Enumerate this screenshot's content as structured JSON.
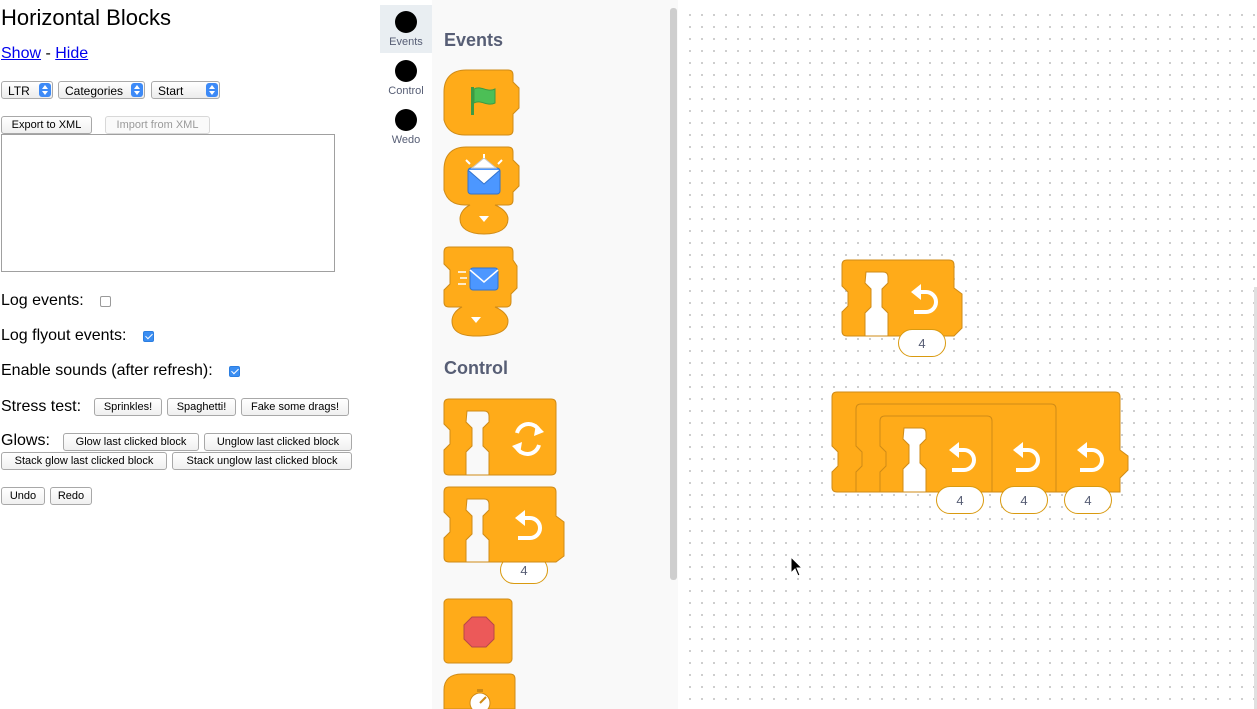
{
  "page": {
    "title": "Horizontal Blocks",
    "show_link": "Show",
    "separator": " - ",
    "hide_link": "Hide"
  },
  "controls": {
    "direction_select": "LTR",
    "toolbox_select": "Categories",
    "position_select": "Start",
    "export_button": "Export to XML",
    "import_button": "Import from XML",
    "xml_textarea_value": "",
    "log_events_label": "Log events:",
    "log_events_checked": false,
    "log_flyout_label": "Log flyout events:",
    "log_flyout_checked": true,
    "sounds_label": "Enable sounds (after refresh):",
    "sounds_checked": true,
    "stress_label": "Stress test:",
    "stress_buttons": [
      "Sprinkles!",
      "Spaghetti!",
      "Fake some drags!"
    ],
    "glows_label": "Glows:",
    "glow_buttons": [
      "Glow last clicked block",
      "Unglow last clicked block",
      "Stack glow last clicked block",
      "Stack unglow last clicked block"
    ],
    "undo_button": "Undo",
    "redo_button": "Redo"
  },
  "categories": [
    {
      "label": "Events",
      "active": true
    },
    {
      "label": "Control",
      "active": false
    },
    {
      "label": "Wedo",
      "active": false
    }
  ],
  "flyout": {
    "events_heading": "Events",
    "control_heading": "Control",
    "repeat_count": "4"
  },
  "workspace": {
    "repeat_block_count": "4",
    "nested_repeat_counts": [
      "4",
      "4",
      "4"
    ]
  },
  "colors": {
    "block_fill": "#ffab19",
    "block_stroke": "#cf8b17",
    "heading_text": "#575e75",
    "checkbox_blue": "#3b8ef2",
    "stop_red": "#ec5959",
    "flag_green": "#4cbf56"
  },
  "icons": [
    "green-flag-icon",
    "broadcast-receive-icon",
    "broadcast-send-icon",
    "forever-arrows-icon",
    "repeat-arrow-icon",
    "stop-sign-icon",
    "timer-icon",
    "dropdown-arrow-icon",
    "mouse-cursor-icon"
  ]
}
